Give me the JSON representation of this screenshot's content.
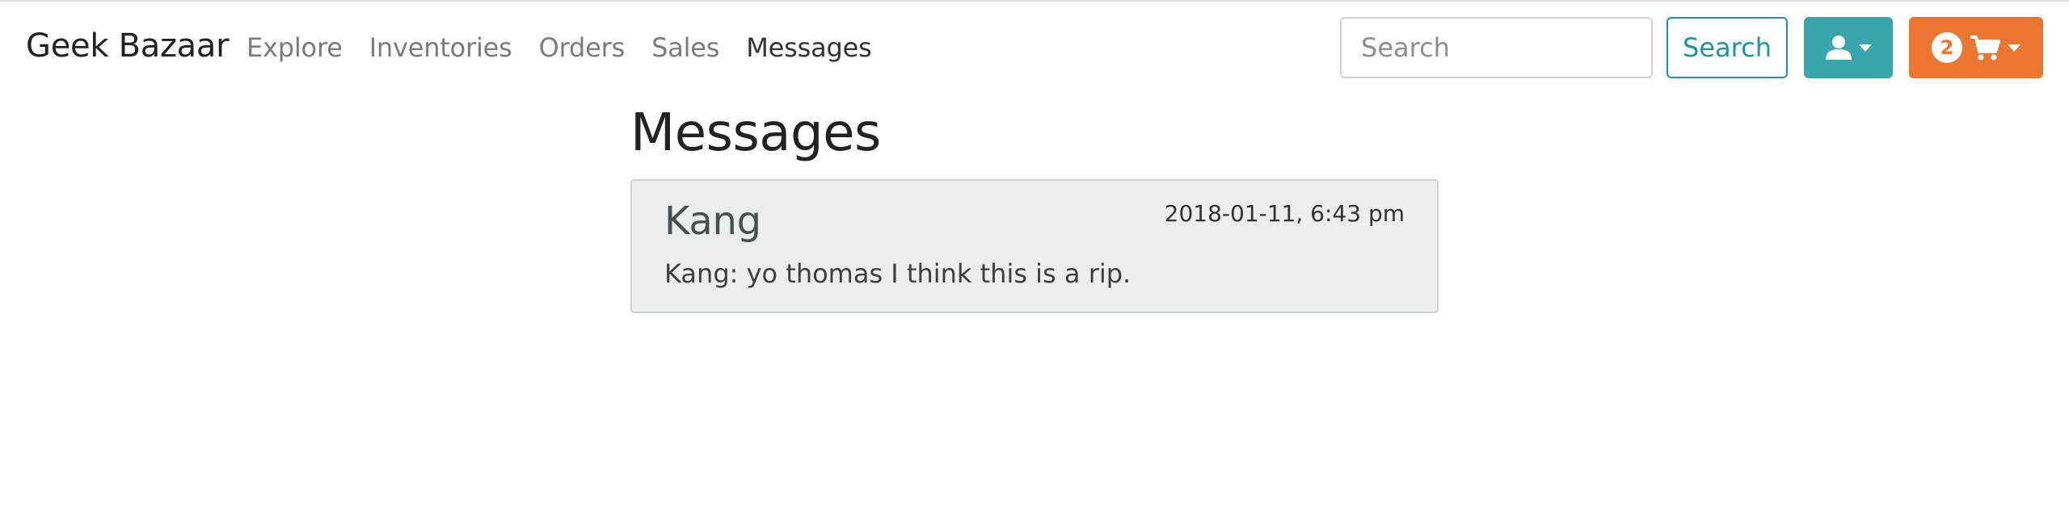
{
  "nav": {
    "brand": "Geek Bazaar",
    "links": [
      "Explore",
      "Inventories",
      "Orders",
      "Sales",
      "Messages"
    ],
    "active": "Messages",
    "search_placeholder": "Search",
    "search_button": "Search",
    "cart_count": "2",
    "user_icon": "user-icon",
    "cart_icon": "cart-icon"
  },
  "page": {
    "title": "Messages"
  },
  "messages": [
    {
      "sender": "Kang",
      "timestamp": "2018-01-11, 6:43 pm",
      "text": "Kang: yo thomas I think this is a rip."
    }
  ],
  "colors": {
    "search_accent": "#1e93a6",
    "user_button": "#3ba5ad",
    "cart_button": "#ea7631",
    "card_bg": "#ebeeef"
  }
}
